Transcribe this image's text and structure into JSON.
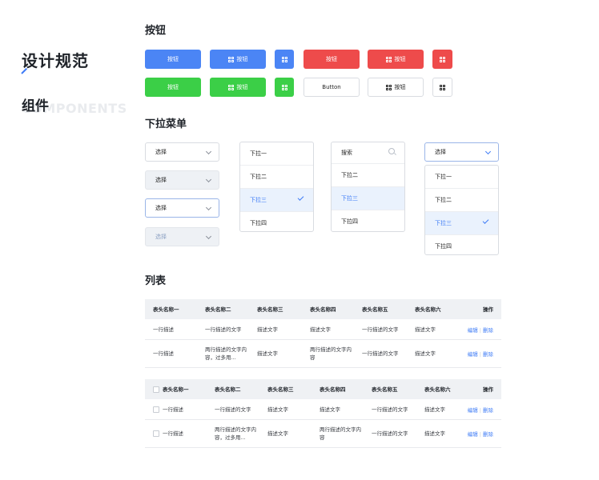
{
  "page": {
    "title": "设计规范",
    "subtitle": "组件",
    "subtitle_en": "COMPONENTS"
  },
  "sections": {
    "buttons": "按钮",
    "dropdowns": "下拉菜单",
    "lists": "列表"
  },
  "buttons": {
    "label": "按钮",
    "english_label": "Button",
    "icon": "grid-icon",
    "colors": {
      "blue": "#4b85f5",
      "red": "#ee4b4b",
      "green": "#3bcf47"
    }
  },
  "dropdowns": {
    "select_label": "选择",
    "search_placeholder": "搜索",
    "options": [
      "下拉一",
      "下拉二",
      "下拉三",
      "下拉四"
    ],
    "selected_option": "下拉三",
    "accent": "#3f7cf6"
  },
  "table1": {
    "headers": [
      "表头名称一",
      "表头名称二",
      "表头名称三",
      "表头名称四",
      "表头名称五",
      "表头名称六",
      "操作"
    ],
    "rows": [
      [
        "一行描述",
        "一行描述的文字",
        "描述文字",
        "描述文字",
        "一行描述的文字",
        "描述文字"
      ],
      [
        "一行描述",
        "两行描述的文字内容，过多用...",
        "描述文字",
        "两行描述的文字内容",
        "一行描述的文字",
        "描述文字"
      ]
    ],
    "actions": [
      "编辑",
      "删除"
    ]
  },
  "table2": {
    "headers": [
      "表头名称一",
      "表头名称二",
      "表头名称三",
      "表头名称四",
      "表头名称五",
      "表头名称六",
      "操作"
    ],
    "rows": [
      [
        "一行描述",
        "一行描述的文字",
        "描述文字",
        "描述文字",
        "一行描述的文字",
        "描述文字"
      ],
      [
        "一行描述",
        "两行描述的文字内容，过多用...",
        "描述文字",
        "两行描述的文字内容",
        "一行描述的文字",
        "描述文字"
      ]
    ],
    "actions": [
      "编辑",
      "删除"
    ]
  }
}
